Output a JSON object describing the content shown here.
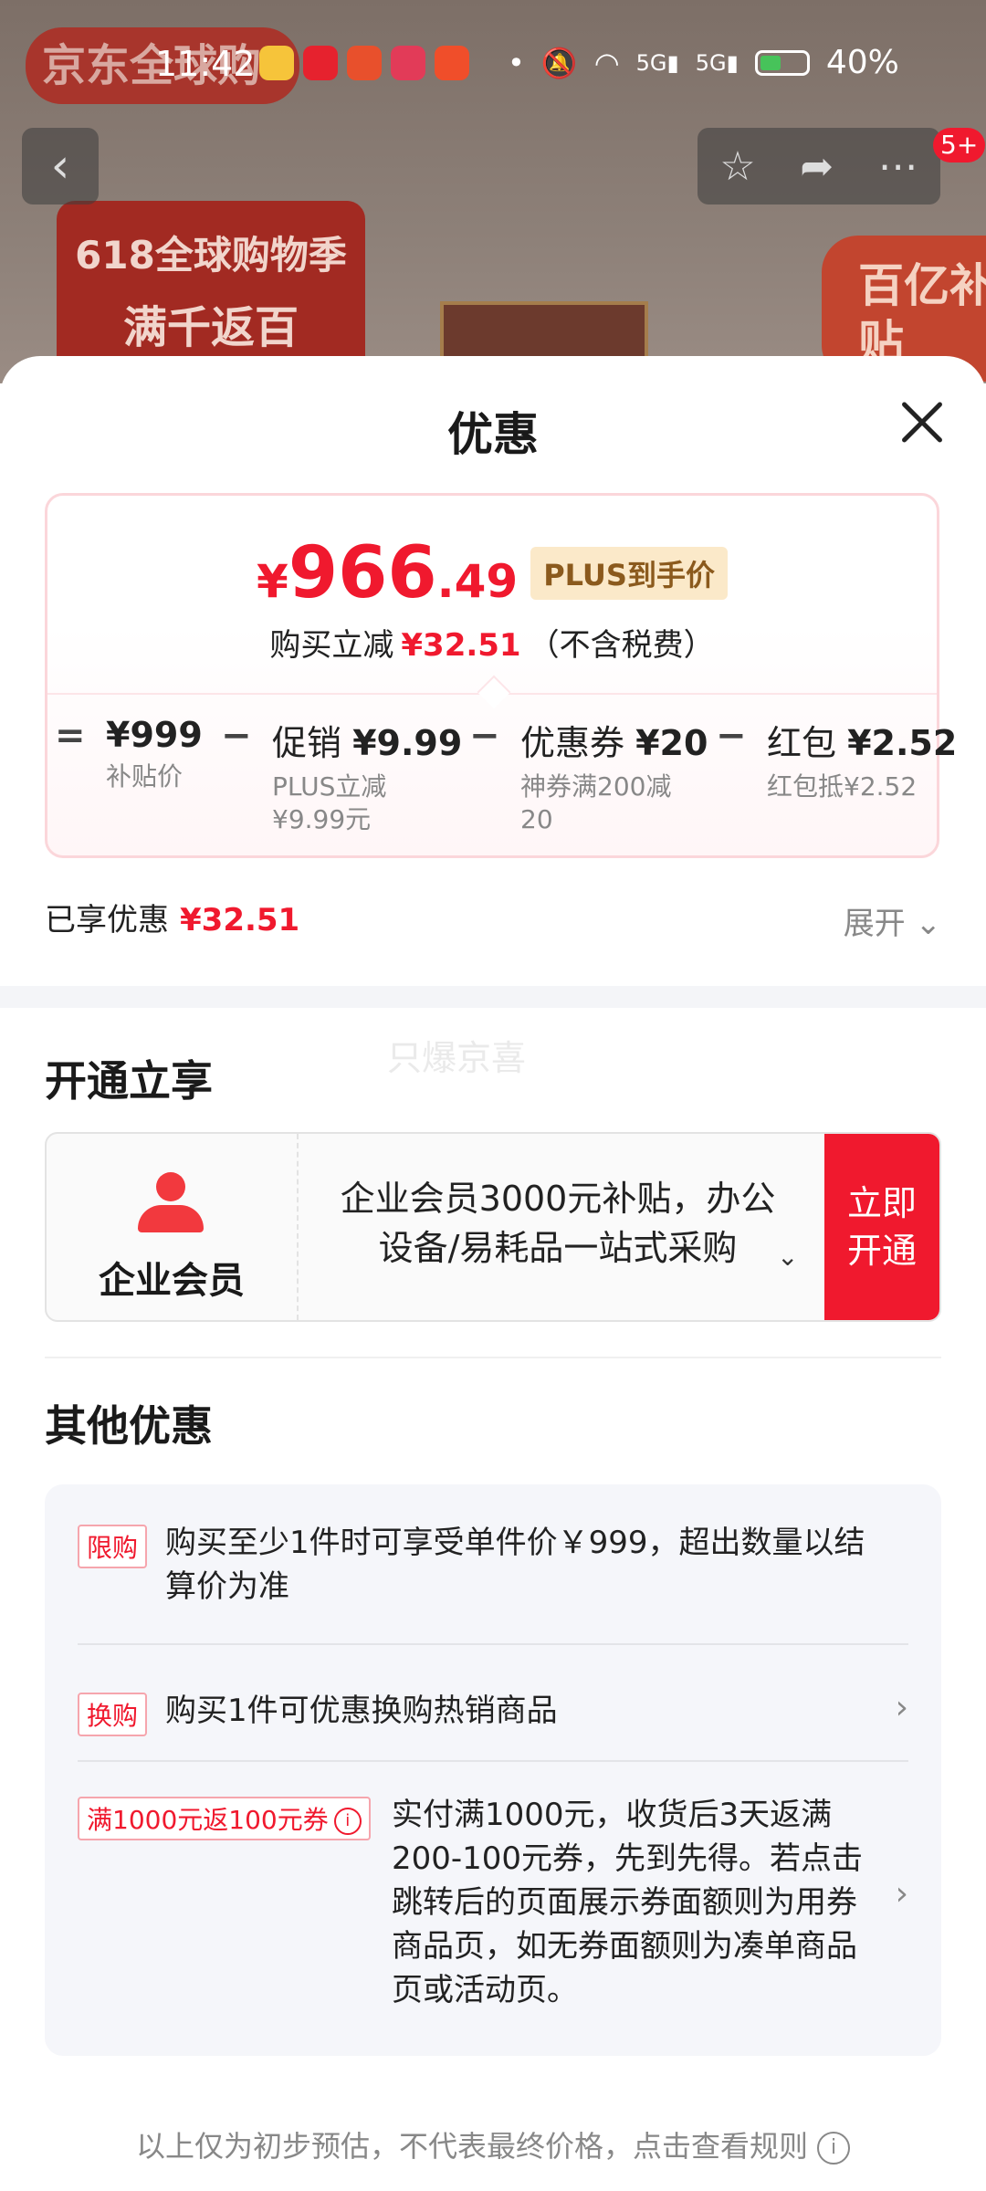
{
  "background": {
    "brand_logo": "京东全球购",
    "promo_line1": "618全球购物季",
    "promo_line2": "满千返百",
    "side_badge": "百亿补贴"
  },
  "status_bar": {
    "time": "11:42",
    "network1": "5G",
    "network2": "5G",
    "battery": "40%"
  },
  "nav": {
    "back_icon": "chevron-left-icon",
    "badge": "5+"
  },
  "sheet": {
    "title": "优惠",
    "price": {
      "currency": "¥",
      "integer": "966",
      "decimal": ".49",
      "tag": "PLUS到手价"
    },
    "reduce": {
      "prefix": "购买立减",
      "amount": "¥32.51",
      "suffix": "（不含税费）"
    },
    "breakdown": [
      {
        "op": "=",
        "main_label": "",
        "main_value": "¥999",
        "sub": "补贴价"
      },
      {
        "op": "−",
        "main_label": "促销",
        "main_value": "¥9.99",
        "sub": "PLUS立减¥9.99元"
      },
      {
        "op": "−",
        "main_label": "优惠券",
        "main_value": "¥20",
        "sub": "神券满200减20"
      },
      {
        "op": "−",
        "main_label": "红包",
        "main_value": "¥2.52",
        "sub": "红包抵¥2.52"
      }
    ],
    "saved_label": "已享优惠",
    "saved_value": "¥32.51",
    "expand_label": "展开"
  },
  "membership": {
    "section_title": "开通立享",
    "watermark": "只爆京喜",
    "name": "企业会员",
    "desc": "企业会员3000元补贴，办公设备/易耗品一站式采购",
    "button_line1": "立即",
    "button_line2": "开通"
  },
  "other_offers": {
    "section_title": "其他优惠",
    "items": [
      {
        "tag": "限购",
        "text": "购买至少1件时可享受单件价￥999，超出数量以结算价为准"
      },
      {
        "tag": "换购",
        "text": "购买1件可优惠换购热销商品"
      },
      {
        "tag": "满1000元返100元券",
        "text": "实付满1000元，收货后3天返满200-100元券，先到先得。若点击跳转后的页面展示券面额则为用券商品页，如无券面额则为凑单商品页或活动页。"
      }
    ]
  },
  "footer": {
    "note": "以上仅为初步预估，不代表最终价格，点击查看规则"
  },
  "colors": {
    "accent": "#f0192e",
    "plus_bg": "#fbe9c9",
    "plus_text": "#8b5a1d"
  }
}
